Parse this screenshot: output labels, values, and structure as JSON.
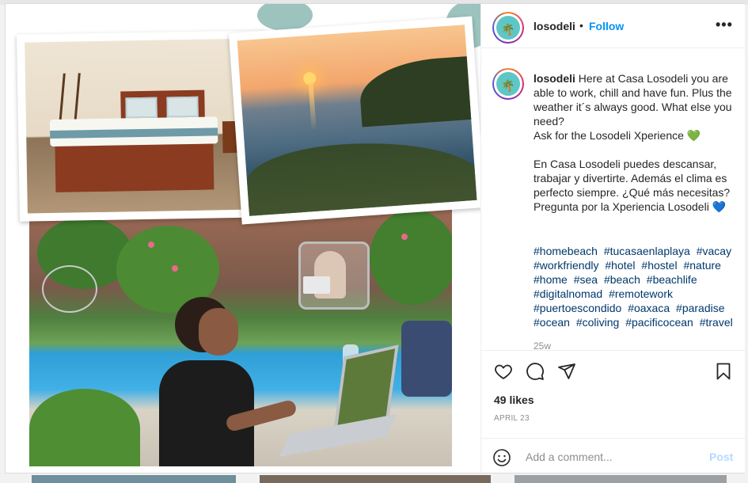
{
  "post": {
    "username": "losodeli",
    "separator": "•",
    "follow_label": "Follow",
    "more_label": "•••",
    "caption_lines": "Here at Casa Losodeli you are able to work, chill and have fun. Plus the weather it´s always good. What else you need?\nAsk for the Losodeli Xperience",
    "caption_heart1": "💚",
    "caption_spanish": "En Casa Losodeli puedes descansar, trabajar y divertirte. Además el clima es perfecto siempre. ¿Qué más necesitas?\nPregunta por la Xperiencia Losodeli",
    "caption_heart2": "💙",
    "hashtags": [
      "#homebeach",
      "#tucasaenlaplaya",
      "#vacay",
      "#workfriendly",
      "#hotel",
      "#hostel",
      "#nature",
      "#home",
      "#sea",
      "#beach",
      "#beachlife",
      "#digitalnomad",
      "#remotework",
      "#puertoescondido",
      "#oaxaca",
      "#paradise",
      "#ocean",
      "#coliving",
      "#pacificocean",
      "#travel"
    ],
    "time_ago": "25w",
    "likes": "49 likes",
    "date": "APRIL 23",
    "comment_placeholder": "Add a comment...",
    "post_label": "Post"
  },
  "colors": {
    "link": "#0095f6",
    "hashtag": "#00376b",
    "muted": "#8e8e8e",
    "post_disabled": "#b3dbff"
  },
  "icons": [
    "heart-icon",
    "comment-icon",
    "share-icon",
    "bookmark-icon",
    "emoji-icon",
    "palm-tree-icon",
    "more-icon"
  ]
}
